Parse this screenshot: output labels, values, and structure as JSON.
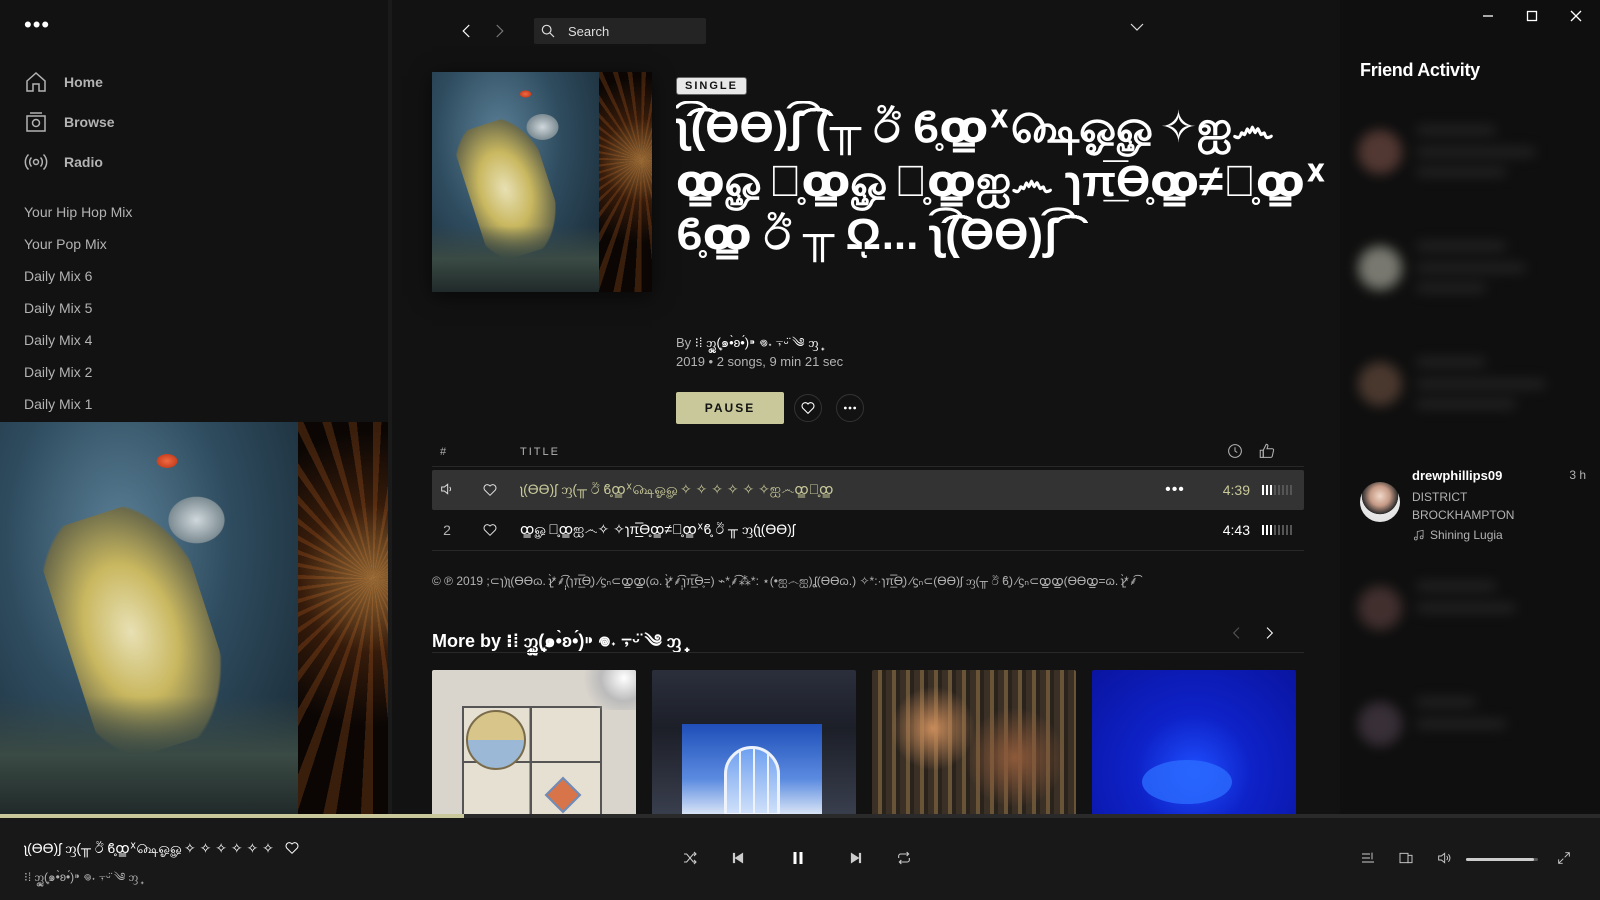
{
  "sidebar": {
    "menu_dots": "•••",
    "nav": [
      {
        "label": "Home",
        "icon": "home-icon"
      },
      {
        "label": "Browse",
        "icon": "browse-icon"
      },
      {
        "label": "Radio",
        "icon": "radio-icon"
      }
    ],
    "playlists": [
      "Your Hip Hop Mix",
      "Your Pop Mix",
      "Daily Mix 6",
      "Daily Mix 5",
      "Daily Mix 4",
      "Daily Mix 2",
      "Daily Mix 1"
    ]
  },
  "topbar": {
    "search_placeholder": "Search",
    "icons": [
      "back-arrow-icon",
      "forward-arrow-icon",
      "search-icon",
      "chevron-down-icon"
    ]
  },
  "album": {
    "type_badge": "SINGLE",
    "title": "ʅ͡͡͡͡͡͡͡͡͡͡͡(ƟӨ)ʃ͡͡͡͡͡͡͡͡͡͡͡͡͡͡ (╥ ඊ ϐ̥ꝏ̳ᕁ௸ஓௐ✧ஐ෴ꝏ̳ௐஞ̥ꝏ̳ௐஞ̥ꝏ̳ஐ෴ ɿπ̲̅̅ϴ̥ꝏ̳≠ஞ̥ꝏ̳ᕁϐ̥ꝏ̳ ඊ ╥ ῼ... ʅ͡͡͡͡͡͡͡͡͡͡͡͡(ƟӨ)ʃ͡͡͡͡͡͡͡͡͡͡͡͡͡͡",
    "by_label": "By",
    "artist": "⁝⁞ ᦀ᩠ᩪᩬ(๑•̀ʚ•́)⁍ 𖦹˖ ⍪ᵕ̈ ༄ ᦀ᩠",
    "meta": "2019 • 2 songs, 9 min 21 sec",
    "pause_label": "PAUSE",
    "icons": [
      "heart-icon",
      "more-icon"
    ]
  },
  "tracklist": {
    "headers": {
      "num": "#",
      "title": "TITLE"
    },
    "header_icons": [
      "clock-icon",
      "thumbs-up-icon"
    ],
    "tracks": [
      {
        "num": "",
        "playing": true,
        "title": "ʅ(ƟӨ)ʃ ᦀ(╥ ඊ ϐ̥ꝏ̳ᕁ௸ஓௐ✧ ✧ ✧ ✧ ✧ ✧ஐ෴ꝏ̳ஐ̥ꝏ̳",
        "duration": "4:39",
        "popularity": 0.4
      },
      {
        "num": "2",
        "playing": false,
        "title": "ꝏ̳ௐஞ̥ꝏ̳ஐ෴✧ ✧ɿπ̲̅̅ϴ̥ꝏ̳≠ஞ̥ꝏ̳ᕁϐ̥ ඊ ╥ ᦀ(ʅ(ƟӨ)ʃ",
        "duration": "4:43",
        "popularity": 0.4
      }
    ]
  },
  "copyright": "© ℗ 2019 ;⊂ɿ)ʅ(ƟӨɷ. ʅ̷̤̀*⸙̩̩̩̩̩̩̩̩͡(ɿπ̲̅̅ϴ̥) ∕ϛₙ⊂ꝏ̳ꝏ̳(ɷ. ʅ̷̤̀*⸙̩̩͡ɿπ̲̅̅ϴ̥=) ⌁*̩⸙͡⁂*: ⋆(•ஐ෴ஐ)ʆ(ƟӨɷ.) ✧*:·ɿπ̲̅̅ϴ̥) ∕ϛₙ⊂(ƟӨ)ʃ ᦀ(╥ ඊ ϐ̥) ∕ϛₙ⊂ꝏ̳ꝏ̳(ƟӨꝏ̳=ɷ. ʅ̷̤̀*⸙͡",
  "more_by": {
    "heading": "More by ⁝⁞ ᦀ᩠ᩪᩬ(๑•̀ʚ•́)⁍ 𖦹˖ ⍪ᵕ̈ ༄ ᦀ᩠",
    "icons": [
      "prev-arrow-icon",
      "next-arrow-icon"
    ]
  },
  "friend_activity": {
    "title": "Friend Activity",
    "friend": {
      "name": "drewphillips09",
      "time": "3 h",
      "track": "DISTRICT",
      "artist": "BROCKHAMPTON",
      "context": "Shining Lugia"
    }
  },
  "now_playing": {
    "title": "ʅ(ƟӨ)ʃ ᦀ(╥ ඊ ϐ̥ꝏ̳ᕁ௸ஓௐ✧ ✧ ✧ ✧ ✧ ✧ஐ෴",
    "artist": "⁝⁞ ᦀ᩠ᩪᩬ(๑•̀ʚ•́)⁍ 𖦹˖ ⍪ᵕ̈ ༄ ᦀ᩠",
    "progress": 0.29,
    "volume": 0.95,
    "controls": [
      "shuffle-icon",
      "previous-icon",
      "pause-icon",
      "next-icon",
      "repeat-icon"
    ],
    "right_controls": [
      "queue-icon",
      "devices-icon",
      "volume-icon",
      "fullscreen-icon"
    ]
  },
  "colors": {
    "accent": "#c8c89a",
    "background": "#121212",
    "player_bar": "#181818",
    "active_row": "#333333"
  }
}
